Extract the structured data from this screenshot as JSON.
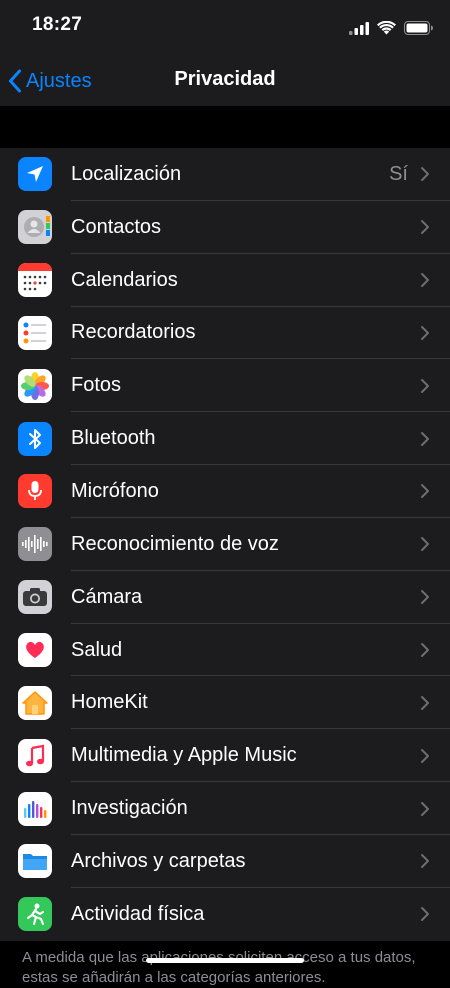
{
  "status_bar": {
    "time": "18:27",
    "signal_icon": "cellular-signal-icon",
    "wifi_icon": "wifi-icon",
    "battery_icon": "battery-icon"
  },
  "nav": {
    "back_label": "Ajustes",
    "title": "Privacidad",
    "back_icon": "chevron-left-icon"
  },
  "items": [
    {
      "label": "Localización",
      "value": "Sí",
      "icon": "location-arrow-icon",
      "icon_color": "#0a84ff"
    },
    {
      "label": "Contactos",
      "value": "",
      "icon": "contacts-icon",
      "icon_color": "#d1d1d6"
    },
    {
      "label": "Calendarios",
      "value": "",
      "icon": "calendar-icon",
      "icon_color": "#ffffff"
    },
    {
      "label": "Recordatorios",
      "value": "",
      "icon": "reminders-icon",
      "icon_color": "#ffffff"
    },
    {
      "label": "Fotos",
      "value": "",
      "icon": "photos-icon",
      "icon_color": "#ffffff"
    },
    {
      "label": "Bluetooth",
      "value": "",
      "icon": "bluetooth-icon",
      "icon_color": "#0a84ff"
    },
    {
      "label": "Micrófono",
      "value": "",
      "icon": "microphone-icon",
      "icon_color": "#ff3b30"
    },
    {
      "label": "Reconocimiento de voz",
      "value": "",
      "icon": "speech-waveform-icon",
      "icon_color": "#8e8e93"
    },
    {
      "label": "Cámara",
      "value": "",
      "icon": "camera-icon",
      "icon_color": "#8e8e93"
    },
    {
      "label": "Salud",
      "value": "",
      "icon": "health-heart-icon",
      "icon_color": "#ffffff"
    },
    {
      "label": "HomeKit",
      "value": "",
      "icon": "home-icon",
      "icon_color": "#ffffff"
    },
    {
      "label": "Multimedia y Apple Music",
      "value": "",
      "icon": "music-note-icon",
      "icon_color": "#ffffff"
    },
    {
      "label": "Investigación",
      "value": "",
      "icon": "research-icon",
      "icon_color": "#ffffff"
    },
    {
      "label": "Archivos y carpetas",
      "value": "",
      "icon": "folder-icon",
      "icon_color": "#1e88e5"
    },
    {
      "label": "Actividad física",
      "value": "",
      "icon": "fitness-runner-icon",
      "icon_color": "#34c759"
    }
  ],
  "footer_text": "A medida que las aplicaciones soliciten acceso a tus datos, estas se añadirán a las categorías anteriores."
}
